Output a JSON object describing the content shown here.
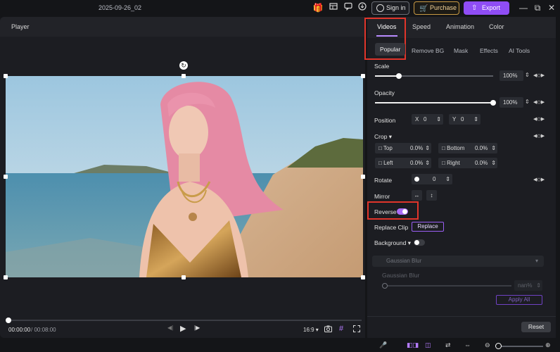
{
  "window": {
    "title": "2025-09-26_02"
  },
  "topbar": {
    "sign_in": "Sign in",
    "purchase": "Purchase",
    "export": "Export"
  },
  "player": {
    "title": "Player",
    "time_current": "00:00:00",
    "time_separator": "/",
    "time_total": "00:08:00",
    "aspect_ratio": "16:9",
    "progress": 0.0
  },
  "panel": {
    "tabs": [
      "Videos",
      "Speed",
      "Animation",
      "Color"
    ],
    "active_tab": "Videos",
    "subtabs": [
      "Popular",
      "Remove BG",
      "Mask",
      "Effects",
      "AI Tools"
    ],
    "active_subtab": "Popular",
    "scale": {
      "label": "Scale",
      "value": "100%",
      "level": 0.2
    },
    "opacity": {
      "label": "Opacity",
      "value": "100%",
      "level": 1.0
    },
    "position": {
      "label": "Position",
      "x_label": "X",
      "x_value": "0",
      "y_label": "Y",
      "y_value": "0"
    },
    "crop": {
      "label": "Crop",
      "top_label": "Top",
      "top_value": "0.0%",
      "bottom_label": "Bottom",
      "bottom_value": "0.0%",
      "left_label": "Left",
      "left_value": "0.0%",
      "right_label": "Right",
      "right_value": "0.0%"
    },
    "rotate": {
      "label": "Rotate",
      "value": "0"
    },
    "mirror": {
      "label": "Mirror"
    },
    "reverse": {
      "label": "Reverse",
      "on": true
    },
    "replace_clip": {
      "label": "Replace Clip",
      "button": "Replace"
    },
    "background": {
      "label": "Background",
      "on": false,
      "dropdown_value": "Gaussian Blur",
      "blur_label": "Gaussian Blur",
      "blur_value": "nan%",
      "apply_all": "Apply All"
    },
    "reset": "Reset"
  },
  "colors": {
    "accent": "#8f4df5",
    "highlight": "#e0352b",
    "toggle_on": "#a96cf7"
  }
}
